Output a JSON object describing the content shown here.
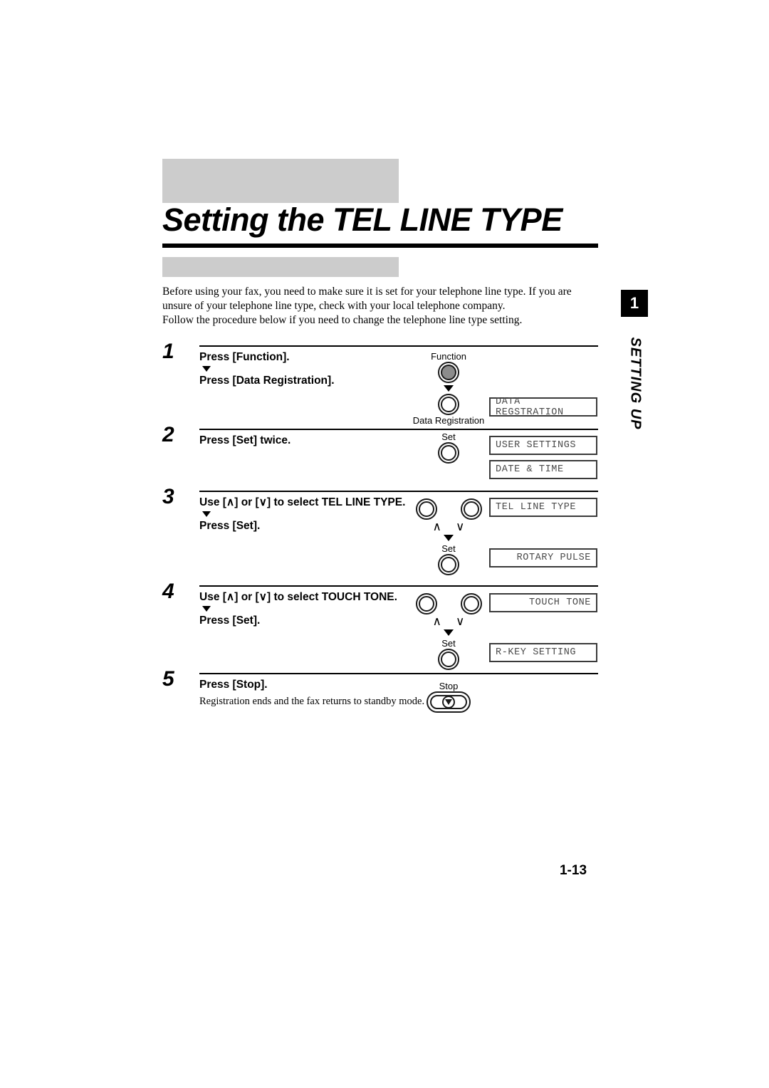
{
  "document": {
    "title": "Setting the TEL LINE TYPE",
    "page_number": "1-13"
  },
  "side_tab": {
    "chapter_number": "1",
    "chapter_label": "SETTING UP"
  },
  "intro": {
    "paragraph_1": "Before using your fax, you need to make sure it is set for your telephone line type. If you are unsure of your telephone line type, check with your local telephone company.",
    "paragraph_2": "Follow the procedure below if you need to change the telephone line type setting."
  },
  "steps": [
    {
      "number": "1",
      "lines": [
        "Press [Function].",
        "Press [Data Registration]."
      ],
      "note": "",
      "buttons": [
        {
          "label": "Function",
          "label_position": "above",
          "type": "circle-filled"
        },
        {
          "label": "Data Registration",
          "label_position": "below",
          "type": "circle"
        }
      ],
      "lcds": [
        {
          "text": "DATA REGSTRATION",
          "align": "left"
        }
      ]
    },
    {
      "number": "2",
      "lines": [
        "Press [Set] twice."
      ],
      "note": "",
      "buttons": [
        {
          "label": "Set",
          "label_position": "above",
          "type": "circle"
        }
      ],
      "lcds": [
        {
          "text": "USER SETTINGS",
          "align": "left"
        },
        {
          "text": "DATE & TIME",
          "align": "left"
        }
      ]
    },
    {
      "number": "3",
      "lines": [
        "Use [∧] or [∨] to select TEL LINE TYPE.",
        "Press [Set]."
      ],
      "note": "",
      "buttons": [
        {
          "label": "",
          "label_position": "none",
          "type": "arrow-pair",
          "glyph_up": "∧",
          "glyph_down": "∨"
        },
        {
          "label": "Set",
          "label_position": "above",
          "type": "circle"
        }
      ],
      "lcds": [
        {
          "text": "TEL LINE TYPE",
          "align": "left"
        },
        {
          "text": "ROTARY PULSE",
          "align": "right"
        }
      ]
    },
    {
      "number": "4",
      "lines": [
        "Use [∧] or [∨] to select TOUCH TONE.",
        "Press [Set]."
      ],
      "note": "",
      "buttons": [
        {
          "label": "",
          "label_position": "none",
          "type": "arrow-pair",
          "glyph_up": "∧",
          "glyph_down": "∨"
        },
        {
          "label": "Set",
          "label_position": "above",
          "type": "circle"
        }
      ],
      "lcds": [
        {
          "text": "TOUCH TONE",
          "align": "right"
        },
        {
          "text": "R-KEY SETTING",
          "align": "left"
        }
      ]
    },
    {
      "number": "5",
      "lines": [
        "Press [Stop]."
      ],
      "note": "Registration ends and the fax returns to standby mode.",
      "buttons": [
        {
          "label": "Stop",
          "label_position": "above",
          "type": "stop"
        }
      ],
      "lcds": []
    }
  ],
  "colors": {
    "gray_block": "#cccccc",
    "button_fill": "#8c8c8c",
    "lcd_text": "#4a4a4a",
    "rule": "#000000"
  }
}
